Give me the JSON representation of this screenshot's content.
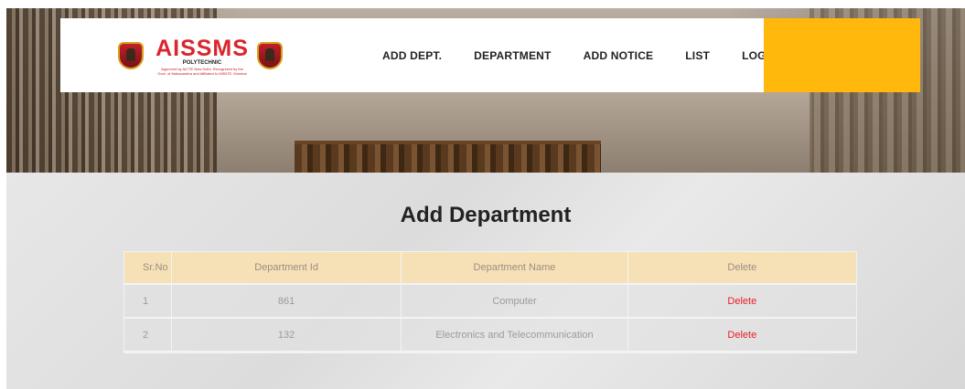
{
  "brand": {
    "name": "AISSMS",
    "subtitle": "POLYTECHNIC",
    "tagline_1": "Approved by AICTE New Delhi, Recognized by the",
    "tagline_2": "Govt. of Maharashtra and Affiliated to MSBTE, Mumbai"
  },
  "nav": {
    "items": [
      {
        "label": "ADD DEPT."
      },
      {
        "label": "DEPARTMENT"
      },
      {
        "label": "ADD NOTICE"
      },
      {
        "label": "LIST"
      },
      {
        "label": "LOGOUT"
      }
    ]
  },
  "colors": {
    "accent": "#ffb80b",
    "header_row": "#f6e1b7",
    "delete": "#e8202a",
    "brand_red": "#d9262c"
  },
  "page": {
    "title": "Add Department"
  },
  "table": {
    "headers": [
      "Sr.No",
      "Department Id",
      "Department Name",
      "Delete"
    ],
    "rows": [
      {
        "sr": "1",
        "id": "861",
        "name": "Computer",
        "action": "Delete"
      },
      {
        "sr": "2",
        "id": "132",
        "name": "Electronics and Telecommunication",
        "action": "Delete"
      }
    ]
  }
}
